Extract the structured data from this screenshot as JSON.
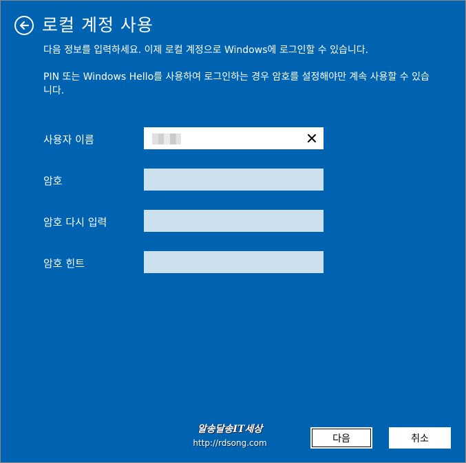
{
  "header": {
    "title": "로컬 계정 사용"
  },
  "description": {
    "line1": "다음 정보를 입력하세요. 이제 로컬 계정으로 Windows에 로그인할 수 있습니다.",
    "line2": "PIN 또는 Windows Hello를 사용하여 로그인하는 경우 암호를 설정해야만 계속 사용할 수 있습니다."
  },
  "form": {
    "fields": [
      {
        "label": "사용자 이름",
        "value": ""
      },
      {
        "label": "암호",
        "value": ""
      },
      {
        "label": "암호 다시 입력",
        "value": ""
      },
      {
        "label": "암호 힌트",
        "value": ""
      }
    ]
  },
  "watermark": {
    "title": "알송달송IT세상",
    "url": "http://rdsong.com"
  },
  "buttons": {
    "next": "다음",
    "cancel": "취소"
  },
  "colors": {
    "background": "#0063b1",
    "inactive_field": "#cde0ee",
    "text": "#ffffff"
  },
  "icons": {
    "back": "back-arrow-circle-icon",
    "clear": "close-icon"
  }
}
